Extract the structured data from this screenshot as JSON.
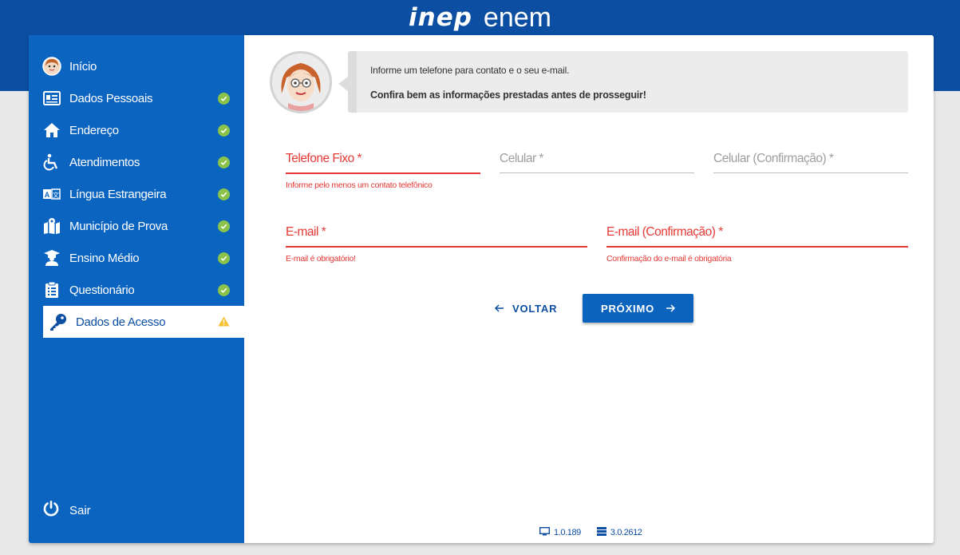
{
  "header": {
    "logo_inep": "inep",
    "logo_enem": "enem",
    "background": "#0b4ea2"
  },
  "sidebar": {
    "background": "#0a64c0",
    "items": [
      {
        "label": "Início",
        "icon": "avatar-icon",
        "status": "none"
      },
      {
        "label": "Dados Pessoais",
        "icon": "id-card-icon",
        "status": "complete"
      },
      {
        "label": "Endereço",
        "icon": "home-icon",
        "status": "complete"
      },
      {
        "label": "Atendimentos",
        "icon": "wheelchair-icon",
        "status": "complete"
      },
      {
        "label": "Língua Estrangeira",
        "icon": "translate-icon",
        "status": "complete"
      },
      {
        "label": "Município de Prova",
        "icon": "map-icon",
        "status": "complete"
      },
      {
        "label": "Ensino Médio",
        "icon": "graduate-icon",
        "status": "complete"
      },
      {
        "label": "Questionário",
        "icon": "clipboard-icon",
        "status": "complete"
      },
      {
        "label": "Dados de Acesso",
        "icon": "key-icon",
        "status": "warning"
      }
    ],
    "logout_label": "Sair"
  },
  "message": {
    "line1": "Informe um telefone para contato e o seu e-mail.",
    "line2": "Confira bem as informações prestadas antes de prosseguir!"
  },
  "form": {
    "telefone_fixo": {
      "label": "Telefone Fixo *",
      "value": "",
      "error": "Informe pelo menos um contato telefônico"
    },
    "celular": {
      "label": "Celular *",
      "value": ""
    },
    "celular_confirmacao": {
      "label": "Celular (Confirmação) *",
      "value": ""
    },
    "email": {
      "label": "E-mail *",
      "value": "",
      "error": "E-mail é obrigatório!"
    },
    "email_confirmacao": {
      "label": "E-mail (Confirmação) *",
      "value": "",
      "error": "Confirmação do e-mail é obrigatória"
    }
  },
  "actions": {
    "back_label": "VOLTAR",
    "next_label": "PRÓXIMO"
  },
  "footer": {
    "client_version": "1.0.189",
    "server_version": "3.0.2612"
  },
  "colors": {
    "error": "#e53935",
    "success": "#8bc34a",
    "warning": "#f5c12e",
    "primary": "#0b63bd"
  }
}
